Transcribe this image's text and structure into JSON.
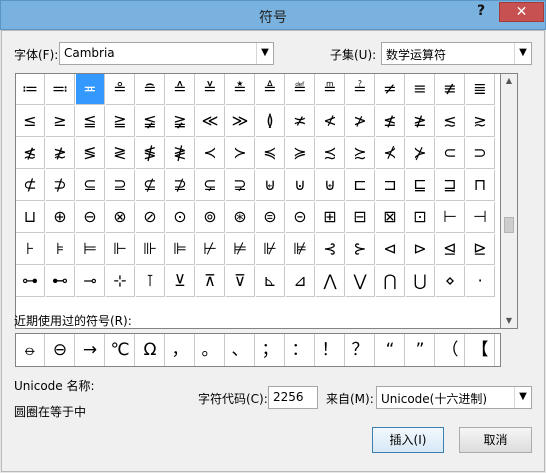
{
  "window": {
    "title": "符号",
    "help": "?",
    "close": "✕"
  },
  "font_label": "字体(F):",
  "font_value": "Cambria",
  "subset_label": "子集(U):",
  "subset_value": "数学运算符",
  "symbols": [
    [
      "≔",
      "≕",
      "≖",
      "≗",
      "≘",
      "≙",
      "≚",
      "≛",
      "≜",
      "≝",
      "≞",
      "≟",
      "≠",
      "≡",
      "≢",
      "≣"
    ],
    [
      "≤",
      "≥",
      "≦",
      "≧",
      "≨",
      "≩",
      "≪",
      "≫",
      "≬",
      "≭",
      "≮",
      "≯",
      "≰",
      "≱",
      "≲",
      "≳"
    ],
    [
      "≴",
      "≵",
      "≶",
      "≷",
      "≸",
      "≹",
      "≺",
      "≻",
      "≼",
      "≽",
      "≾",
      "≿",
      "⊀",
      "⊁",
      "⊂",
      "⊃"
    ],
    [
      "⊄",
      "⊅",
      "⊆",
      "⊇",
      "⊈",
      "⊉",
      "⊊",
      "⊋",
      "⊌",
      "⊍",
      "⊎",
      "⊏",
      "⊐",
      "⊑",
      "⊒",
      "⊓"
    ],
    [
      "⊔",
      "⊕",
      "⊖",
      "⊗",
      "⊘",
      "⊙",
      "⊚",
      "⊛",
      "⊜",
      "⊝",
      "⊞",
      "⊟",
      "⊠",
      "⊡",
      "⊢",
      "⊣"
    ],
    [
      "⊦",
      "⊧",
      "⊨",
      "⊩",
      "⊪",
      "⊫",
      "⊬",
      "⊭",
      "⊮",
      "⊯",
      "⊰",
      "⊱",
      "⊲",
      "⊳",
      "⊴",
      "⊵"
    ],
    [
      "⊶",
      "⊷",
      "⊸",
      "⊹",
      "⊺",
      "⊻",
      "⊼",
      "⊽",
      "⊾",
      "⊿",
      "⋀",
      "⋁",
      "⋂",
      "⋃",
      "⋄",
      "⋅"
    ]
  ],
  "selected_symbol": "≖",
  "recent_label": "近期使用过的符号(R):",
  "recent_symbols": [
    "⦵",
    "⊖",
    "→",
    "℃",
    "Ω",
    "，",
    "。",
    "、",
    "；",
    "：",
    "！",
    "？",
    "“",
    "”",
    "（",
    "【"
  ],
  "unicode_name_label": "Unicode 名称:",
  "unicode_name_value": "圆圈在等于中",
  "char_code_label": "字符代码(C):",
  "char_code_value": "2256",
  "from_label": "来自(M):",
  "from_value": "Unicode(十六进制)",
  "insert_button": "插入(I)",
  "cancel_button": "取消"
}
